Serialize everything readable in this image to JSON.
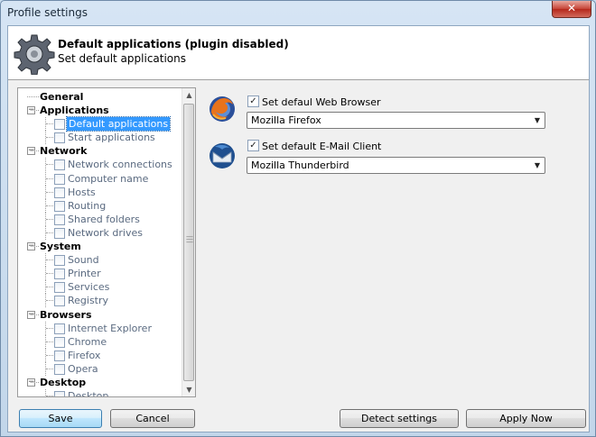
{
  "window": {
    "title": "Profile settings",
    "close_glyph": "✕"
  },
  "header": {
    "title": "Default applications (plugin disabled)",
    "subtitle": "Set default applications",
    "icon": "gear-icon"
  },
  "tree": {
    "categories": [
      {
        "label": "General",
        "expander": "",
        "items": []
      },
      {
        "label": "Applications",
        "expander": "−",
        "items": [
          {
            "label": "Default applications",
            "selected": true
          },
          {
            "label": "Start applications"
          }
        ]
      },
      {
        "label": "Network",
        "expander": "−",
        "items": [
          {
            "label": "Network connections"
          },
          {
            "label": "Computer name"
          },
          {
            "label": "Hosts"
          },
          {
            "label": "Routing"
          },
          {
            "label": "Shared folders"
          },
          {
            "label": "Network drives"
          }
        ]
      },
      {
        "label": "System",
        "expander": "−",
        "items": [
          {
            "label": "Sound"
          },
          {
            "label": "Printer"
          },
          {
            "label": "Services"
          },
          {
            "label": "Registry"
          }
        ]
      },
      {
        "label": "Browsers",
        "expander": "−",
        "items": [
          {
            "label": "Internet Explorer"
          },
          {
            "label": "Chrome"
          },
          {
            "label": "Firefox"
          },
          {
            "label": "Opera"
          }
        ]
      },
      {
        "label": "Desktop",
        "expander": "−",
        "items": [
          {
            "label": "Desktop"
          }
        ]
      }
    ]
  },
  "browser": {
    "checkbox_label": "Set defaul Web Browser",
    "checked": true,
    "check_glyph": "✓",
    "selected": "Mozilla Firefox",
    "icon": "firefox-icon"
  },
  "email": {
    "checkbox_label": "Set default E-Mail Client",
    "checked": true,
    "check_glyph": "✓",
    "selected": "Mozilla Thunderbird",
    "icon": "thunderbird-icon"
  },
  "buttons": {
    "save": "Save",
    "cancel": "Cancel",
    "detect": "Detect settings",
    "apply": "Apply Now"
  }
}
